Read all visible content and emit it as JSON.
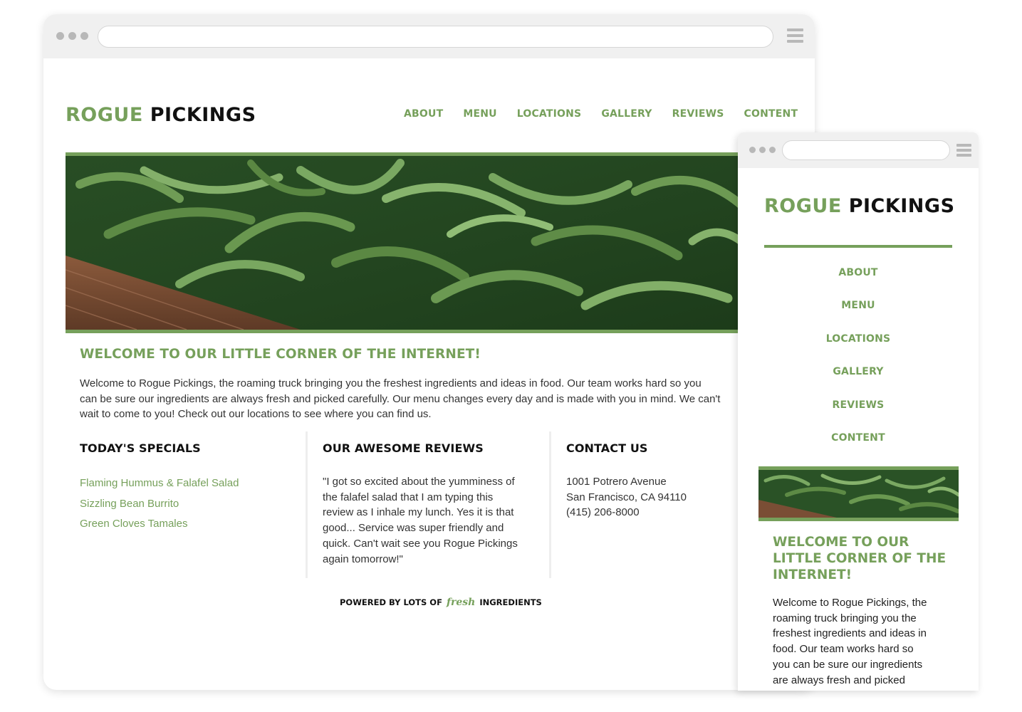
{
  "brand": {
    "part1": "ROGUE",
    "part2": "PICKINGS",
    "accent_color": "#76a05b",
    "dark_color": "#111111"
  },
  "nav": [
    "ABOUT",
    "MENU",
    "LOCATIONS",
    "GALLERY",
    "REVIEWS",
    "CONTENT"
  ],
  "hero": {
    "image": "green beans on a wooden crate"
  },
  "welcome": {
    "heading": "WELCOME TO OUR LITTLE CORNER OF THE INTERNET!",
    "desktop_lines": [
      "Welcome to Rogue Pickings, the roaming truck bringing you the freshest ingredients and ideas in food. Our team works hard so you",
      "can be sure our ingredients are always fresh and picked carefully. Our menu changes every day and is made with you in mind. We can't",
      "wait to come to you! Check out our locations to see where you can find us."
    ]
  },
  "specials": {
    "heading": "TODAY'S SPECIALS",
    "items": [
      "Flaming Hummus & Falafel Salad",
      "Sizzling Bean Burrito",
      "Green Cloves Tamales"
    ]
  },
  "reviews": {
    "heading": "OUR AWESOME REVIEWS",
    "lines": [
      "\"I got so excited about the yumminess of",
      "the falafel salad that I am typing this",
      "review as I inhale my lunch. Yes it is that",
      "good... Service was super friendly and",
      "quick. Can't wait see you Rogue Pickings",
      "again tomorrow!\""
    ]
  },
  "contact": {
    "heading": "CONTACT US",
    "address1": "1001 Potrero Avenue",
    "address2": "San Francisco, CA 94110",
    "phone": "(415) 206-8000"
  },
  "footer": {
    "before": "POWERED BY LOTS OF",
    "fresh": "fresh",
    "after": "INGREDIENTS"
  },
  "mobile": {
    "heading_lines": [
      "WELCOME TO OUR",
      "LITTLE CORNER OF THE",
      "INTERNET!"
    ],
    "intro_lines": [
      "Welcome to Rogue Pickings, the",
      "roaming truck bringing you the",
      "freshest ingredients and ideas in",
      "food. Our team works hard so",
      "you can be sure our ingredients",
      "are always fresh and picked"
    ]
  }
}
